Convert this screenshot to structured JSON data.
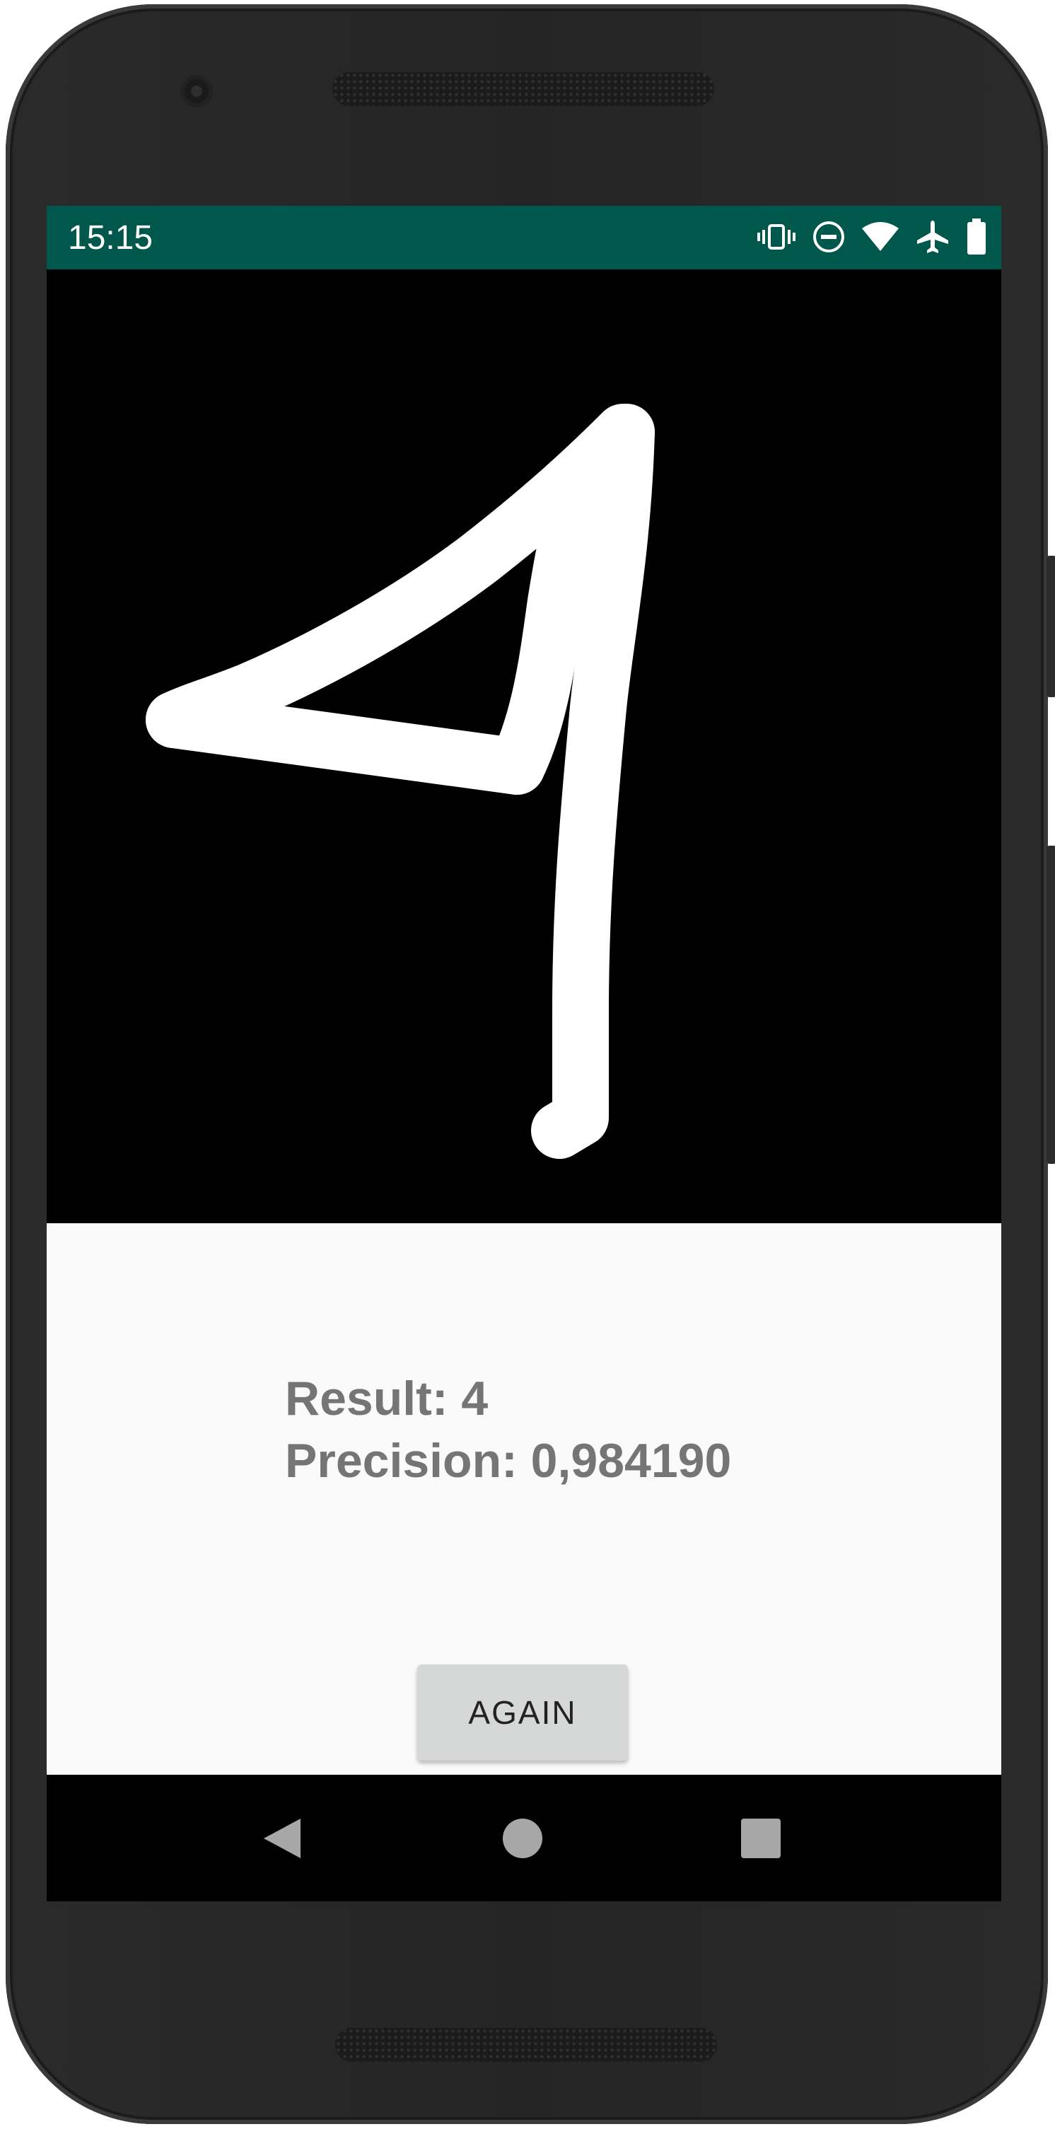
{
  "status_bar": {
    "time": "15:15",
    "icons": [
      "vibrate-icon",
      "do-not-disturb-icon",
      "wifi-icon",
      "airplane-icon",
      "battery-icon"
    ],
    "background_color": "#00574b"
  },
  "drawing_canvas": {
    "drawn_digit": "4",
    "stroke_color": "#ffffff",
    "background_color": "#000000"
  },
  "result": {
    "result_text": "Result: 4",
    "precision_text": "Precision: 0,984190"
  },
  "again_button": {
    "label": "AGAIN"
  },
  "nav_bar": {
    "icons": [
      "back-icon",
      "home-icon",
      "recents-icon"
    ]
  }
}
